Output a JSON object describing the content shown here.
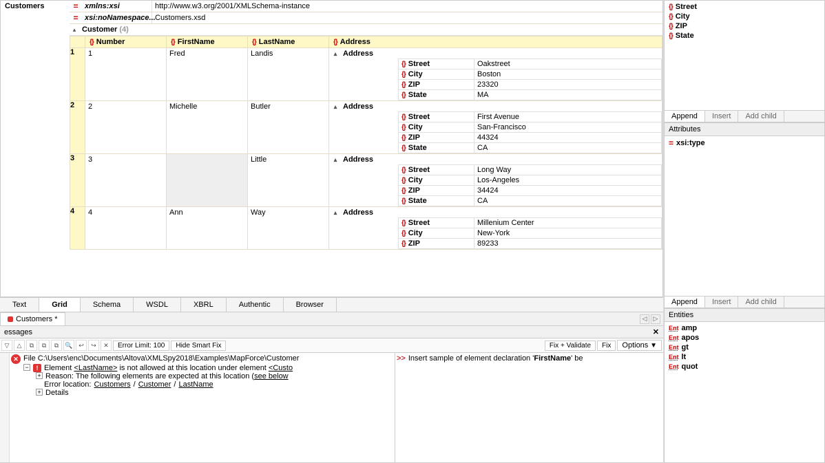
{
  "root_label": "Customers",
  "xmlns_attr_name": "xmlns:xsi",
  "xmlns_attr_val": "http://www.w3.org/2001/XMLSchema-instance",
  "schema_attr_name": "xsi:noNamespace...",
  "schema_attr_val": "Customers.xsd",
  "customer_label": "Customer",
  "customer_count": "(4)",
  "columns": {
    "number": "Number",
    "first": "FirstName",
    "last": "LastName",
    "address": "Address"
  },
  "addr_keys": {
    "street": "Street",
    "city": "City",
    "zip": "ZIP",
    "state": "State"
  },
  "rows": [
    {
      "n": "1",
      "number": "1",
      "first": "Fred",
      "last": "Landis",
      "address": {
        "street": "Oakstreet",
        "city": "Boston",
        "zip": "23320",
        "state": "MA"
      }
    },
    {
      "n": "2",
      "number": "2",
      "first": "Michelle",
      "last": "Butler",
      "address": {
        "street": "First Avenue",
        "city": "San-Francisco",
        "zip": "44324",
        "state": "CA"
      }
    },
    {
      "n": "3",
      "number": "3",
      "first": "",
      "last": "Little",
      "address": {
        "street": "Long Way",
        "city": "Los-Angeles",
        "zip": "34424",
        "state": "CA"
      }
    },
    {
      "n": "4",
      "number": "4",
      "first": "Ann",
      "last": "Way",
      "address": {
        "street": "Millenium Center",
        "city": "New-York",
        "zip": "89233",
        "state": ""
      }
    }
  ],
  "view_tabs": {
    "text": "Text",
    "grid": "Grid",
    "schema": "Schema",
    "wsdl": "WSDL",
    "xbrl": "XBRL",
    "authentic": "Authentic",
    "browser": "Browser"
  },
  "file_tab": "Customers *",
  "messages": {
    "header": "essages",
    "error_limit": "Error Limit: 100",
    "hide_smart": "Hide Smart Fix",
    "fix_validate": "Fix + Validate",
    "fix": "Fix",
    "options": "Options",
    "file_line": "File C:\\Users\\enc\\Documents\\Altova\\XMLSpy2018\\Examples\\MapForce\\Customer",
    "err_line": "Element <LastName> is not allowed at this location under element <Custo",
    "reason_line": "Reason: The following elements are expected at this location (see below",
    "errloc_prefix": "Error location: ",
    "errloc_1": "Customers",
    "errloc_sep": " / ",
    "errloc_2": "Customer",
    "errloc_3": "LastName",
    "details": "Details",
    "suggest_prefix": ">>",
    "suggest": "Insert sample of element declaration 'FirstName' be"
  },
  "right_panel_items": [
    "Street",
    "City",
    "ZIP",
    "State"
  ],
  "actions": {
    "append": "Append",
    "insert": "Insert",
    "addchild": "Add child"
  },
  "attributes_header": "Attributes",
  "attr_item": "xsi:type",
  "entities_header": "Entities",
  "entities": [
    "amp",
    "apos",
    "gt",
    "lt",
    "quot"
  ]
}
